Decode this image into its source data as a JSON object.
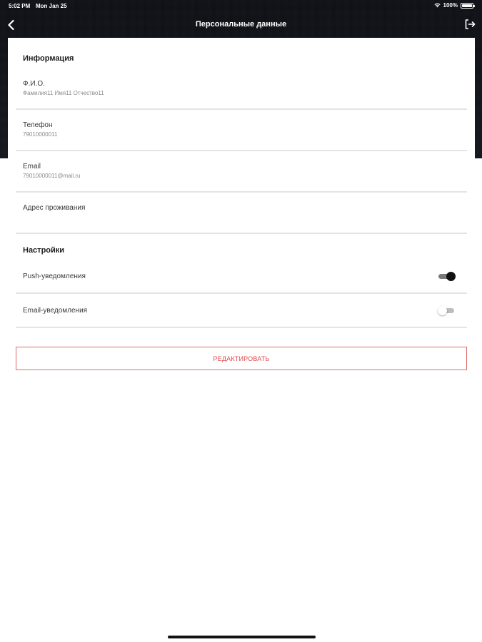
{
  "status_bar": {
    "time": "5:02 PM",
    "date": "Mon Jan 25",
    "battery": "100%"
  },
  "nav": {
    "title": "Персональные данные",
    "back_icon": "chevron-left-icon",
    "logout_icon": "logout-icon"
  },
  "info_section": {
    "title": "Информация",
    "fields": [
      {
        "label": "Ф.И.О.",
        "value": "Фамилия11 Имя11 Отчество11"
      },
      {
        "label": "Телефон",
        "value": "79010000011"
      },
      {
        "label": "Email",
        "value": "79010000011@mail.ru"
      },
      {
        "label": "Адрес проживания",
        "value": ""
      }
    ]
  },
  "settings_section": {
    "title": "Настройки",
    "toggles": [
      {
        "label": "Push-уведомления",
        "on": true
      },
      {
        "label": "Email-уведомления",
        "on": false
      }
    ]
  },
  "edit_button": {
    "label": "РЕДАКТИРОВАТЬ"
  },
  "colors": {
    "accent": "#e04848",
    "divider": "#e4e4e4",
    "header_dark": "#3b3f49"
  }
}
